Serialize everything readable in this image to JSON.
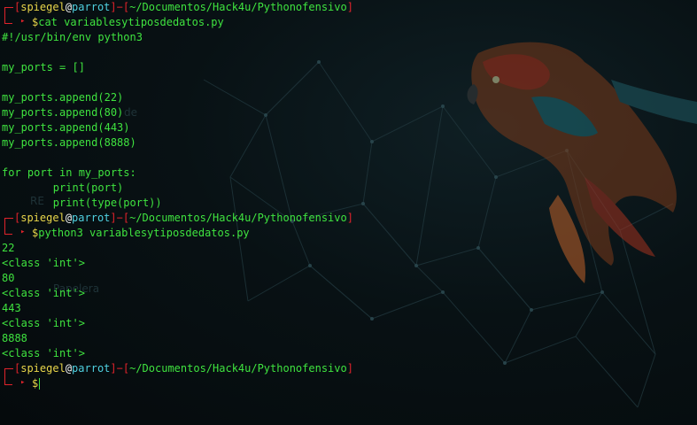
{
  "prompt": {
    "user": "spiegel",
    "at": "@",
    "host": "parrot",
    "path": "~/Documentos/Hack4u/Pythonofensivo",
    "symbol": "$"
  },
  "commands": {
    "cmd1": "cat variablesytiposdedatos.py",
    "cmd2": "python3 variablesytiposdedatos.py",
    "cmd3": ""
  },
  "file_contents": [
    "#!/usr/bin/env python3",
    "",
    "my_ports = []",
    "",
    "my_ports.append(22)",
    "my_ports.append(80)",
    "my_ports.append(443)",
    "my_ports.append(8888)",
    "",
    "for port in my_ports:",
    "        print(port)",
    "        print(type(port))"
  ],
  "output": [
    "22",
    "<class 'int'>",
    "80",
    "<class 'int'>",
    "443",
    "<class 'int'>",
    "8888",
    "<class 'int'>"
  ],
  "colors": {
    "bracket": "#e0232b",
    "user": "#e9d64a",
    "host": "#4fd0e0",
    "text": "#3fe33f"
  }
}
